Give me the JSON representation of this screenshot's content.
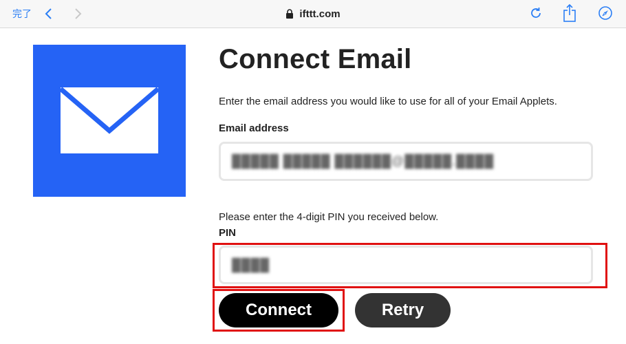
{
  "browser": {
    "done_label": "完了",
    "url": "ifttt.com",
    "icons": [
      "chevron-left-icon",
      "chevron-right-icon",
      "lock-icon",
      "reload-icon",
      "share-icon",
      "compass-icon"
    ]
  },
  "service": {
    "logo_icon": "envelope-icon",
    "logo_color": "#2563f5"
  },
  "main": {
    "title": "Connect Email",
    "description": "Enter the email address you would like to use for all of your Email Applets.",
    "email_label": "Email address",
    "email_value": "█████ █████ ██████@█████.████",
    "pin_help": "Please enter the 4-digit PIN you received below.",
    "pin_label": "PIN",
    "pin_value": "████"
  },
  "actions": {
    "connect_label": "Connect",
    "retry_label": "Retry"
  },
  "colors": {
    "accent": "#2a7ef5",
    "highlight": "#e01010"
  }
}
